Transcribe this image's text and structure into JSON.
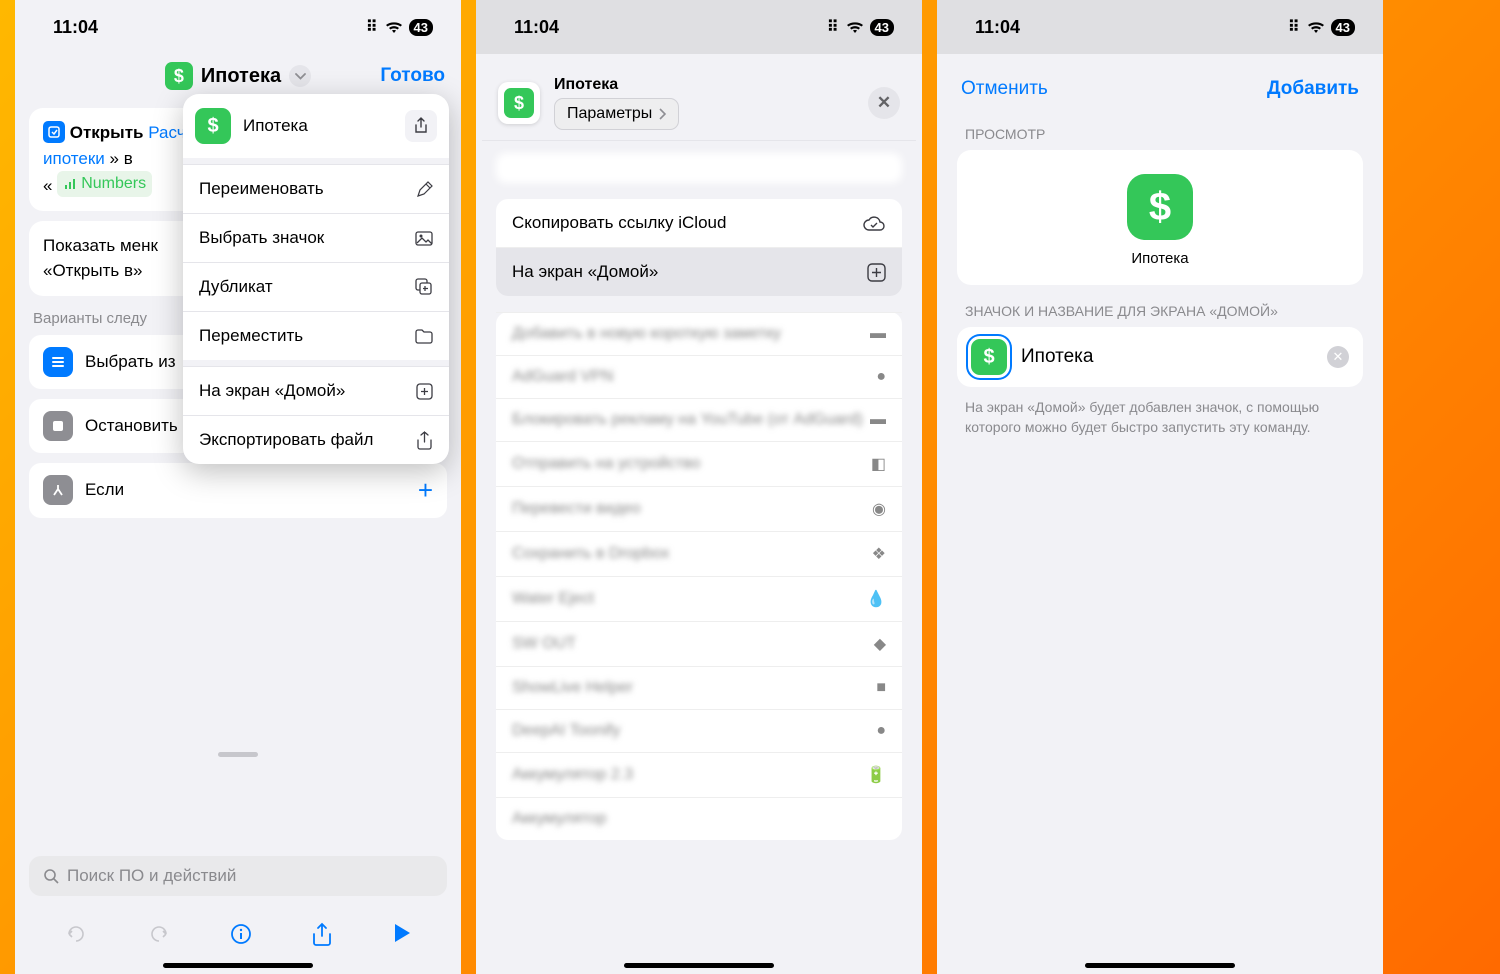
{
  "status": {
    "time": "11:04",
    "battery": "43"
  },
  "p1": {
    "title": "Ипотека",
    "done": "Готово",
    "action": {
      "open": "Открыть",
      "mortgage": "ипотеки",
      "in": "в",
      "numbers": "Numbers",
      "quote": "«"
    },
    "showmenu_l1": "Показать менк",
    "showmenu_l2": "«Открыть в»",
    "next_section": "Варианты следу",
    "rows": {
      "choose": "Выбрать из",
      "stop": "Остановить",
      "if": "Если"
    },
    "popup": {
      "title": "Ипотека",
      "rename": "Переименовать",
      "icon": "Выбрать значок",
      "dup": "Дубликат",
      "move": "Переместить",
      "home": "На экран «Домой»",
      "export": "Экспортировать файл"
    },
    "search": "Поиск ПО и действий"
  },
  "p2": {
    "title": "Ипотека",
    "params": "Параметры",
    "copy": "Скопировать ссылку iCloud",
    "home": "На экран «Домой»",
    "blurred": [
      "Добавить в новую короткую заметку",
      "AdGuard VPN",
      "Блокировать рекламу на YouTube (от AdGuard)",
      "Отправить на устройство",
      "Перевести видео",
      "Сохранить в Dropbox",
      "Water Eject",
      "SW OUT",
      "ShowLive Helper",
      "DeepAI Toonify",
      "Аккумулятор 2.3",
      "Аккумулятор"
    ]
  },
  "p3": {
    "cancel": "Отменить",
    "add": "Добавить",
    "sec1": "ПРОСМОТР",
    "preview_name": "Ипотека",
    "sec2": "ЗНАЧОК И НАЗВАНИЕ ДЛЯ ЭКРАНА «ДОМОЙ»",
    "input": "Ипотека",
    "footer": "На экран «Домой» будет добавлен значок, с помощью которого можно будет быстро запустить эту команду."
  }
}
